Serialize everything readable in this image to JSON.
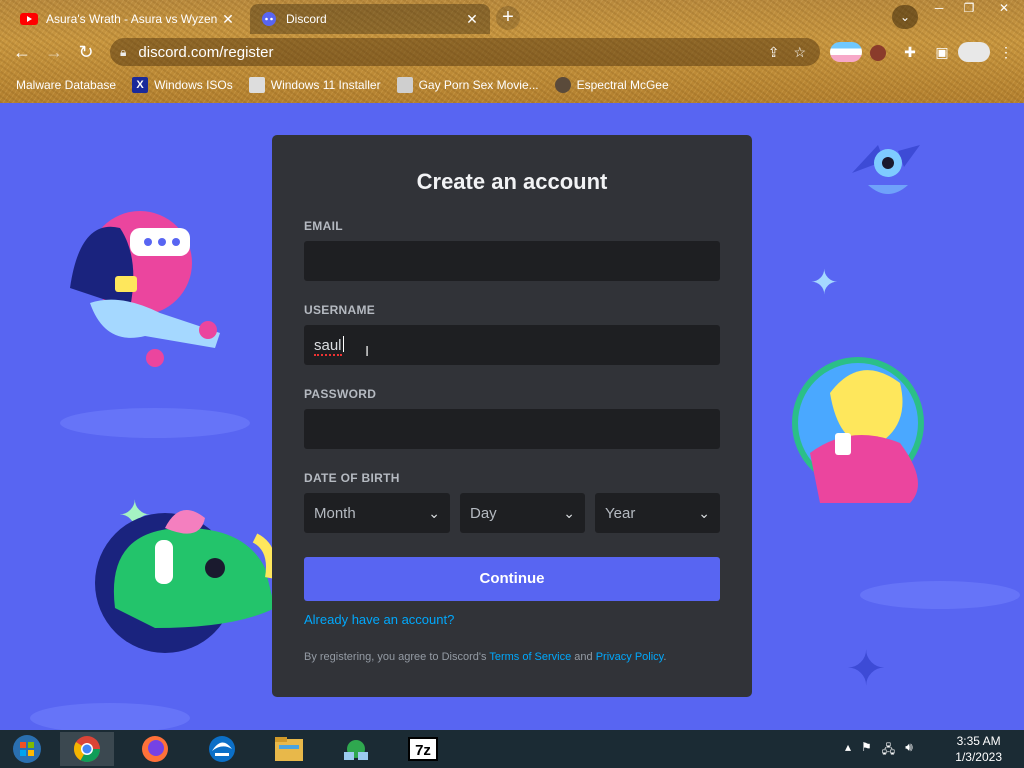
{
  "browser": {
    "tabs": [
      {
        "title": "Asura's Wrath - Asura vs Wyzen",
        "close": "✕"
      },
      {
        "title": "Discord",
        "close": "✕"
      }
    ],
    "new_tab": "+",
    "url": "discord.com/register",
    "bookmarks": [
      {
        "label": "Malware Database",
        "icon": "bookmark-icon"
      },
      {
        "label": "Windows ISOs",
        "icon": "x-logo-icon"
      },
      {
        "label": "Windows 11 Installer",
        "icon": "page-icon"
      },
      {
        "label": "Gay Porn Sex Movie...",
        "icon": "site-icon"
      },
      {
        "label": "Espectral McGee",
        "icon": "avatar-icon"
      }
    ]
  },
  "form": {
    "title": "Create an account",
    "email_label": "EMAIL",
    "email_value": "",
    "username_label": "USERNAME",
    "username_value": "saul",
    "password_label": "PASSWORD",
    "password_value": "",
    "dob_label": "DATE OF BIRTH",
    "month_placeholder": "Month",
    "day_placeholder": "Day",
    "year_placeholder": "Year",
    "continue_label": "Continue",
    "login_link": "Already have an account?",
    "legal_prefix": "By registering, you agree to Discord's ",
    "terms_link": "Terms of Service",
    "legal_and": " and ",
    "privacy_link": "Privacy Policy",
    "legal_suffix": "."
  },
  "colors": {
    "blurple": "#5865f2",
    "card_bg": "#313338",
    "input_bg": "#1e1f22",
    "link": "#00a8fc"
  },
  "taskbar": {
    "apps": [
      "windows-start-icon",
      "chrome-icon",
      "firefox-icon",
      "edge-icon",
      "file-explorer-icon",
      "network-icon",
      "7zip-icon"
    ],
    "seven_zip_label": "7z",
    "time": "3:35 AM",
    "date": "1/3/2023"
  }
}
